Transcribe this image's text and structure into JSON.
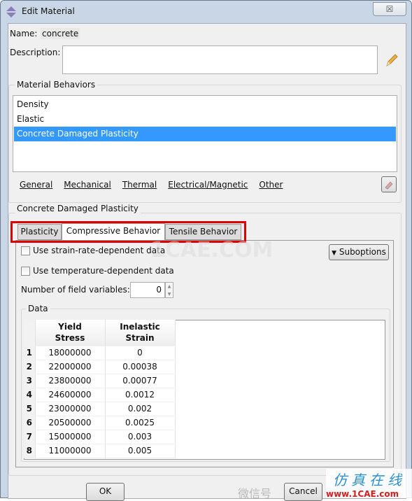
{
  "window": {
    "title": "Edit Material",
    "close_label": "☒"
  },
  "name": {
    "label": "Name:",
    "value": "concrete"
  },
  "description": {
    "label": "Description:",
    "value": ""
  },
  "material_behaviors": {
    "label": "Material Behaviors",
    "items": [
      {
        "label": "Density"
      },
      {
        "label": "Elastic"
      },
      {
        "label": "Concrete Damaged Plasticity",
        "selected": true
      }
    ],
    "menus": [
      {
        "label": "General",
        "mnemonic": "G"
      },
      {
        "label": "Mechanical",
        "mnemonic": "M"
      },
      {
        "label": "Thermal",
        "mnemonic": "T"
      },
      {
        "label": "Electrical/Magnetic",
        "mnemonic": "E"
      },
      {
        "label": "Other",
        "mnemonic": "O"
      }
    ]
  },
  "behavior_panel": {
    "label": "Concrete Damaged Plasticity",
    "tabs": [
      {
        "label": "Plasticity"
      },
      {
        "label": "Compressive Behavior",
        "active": true
      },
      {
        "label": "Tensile Behavior"
      }
    ],
    "strain_rate_label": "Use strain-rate-dependent data",
    "temperature_label": "Use temperature-dependent data",
    "suboptions_label": "Suboptions",
    "field_vars_label": "Number of field variables:",
    "field_vars_value": "0",
    "data_label": "Data",
    "table": {
      "headers": [
        [
          "Yield",
          "Stress"
        ],
        [
          "Inelastic",
          "Strain"
        ]
      ],
      "rows": [
        [
          "1",
          "18000000",
          "0"
        ],
        [
          "2",
          "22000000",
          "0.00038"
        ],
        [
          "3",
          "23800000",
          "0.00077"
        ],
        [
          "4",
          "24600000",
          "0.0012"
        ],
        [
          "5",
          "23000000",
          "0.002"
        ],
        [
          "6",
          "20500000",
          "0.0025"
        ],
        [
          "7",
          "15000000",
          "0.003"
        ],
        [
          "8",
          "11000000",
          "0.005"
        ]
      ]
    }
  },
  "buttons": {
    "ok": "OK",
    "cancel": "Cancel"
  },
  "watermarks": {
    "center": "1CAE.COM",
    "brand_cn": "仿真在线",
    "brand_url": "www.1CAE.com",
    "wechat": "微信号"
  },
  "colors": {
    "selection": "#3399ff",
    "highlight_box": "#e00000"
  }
}
